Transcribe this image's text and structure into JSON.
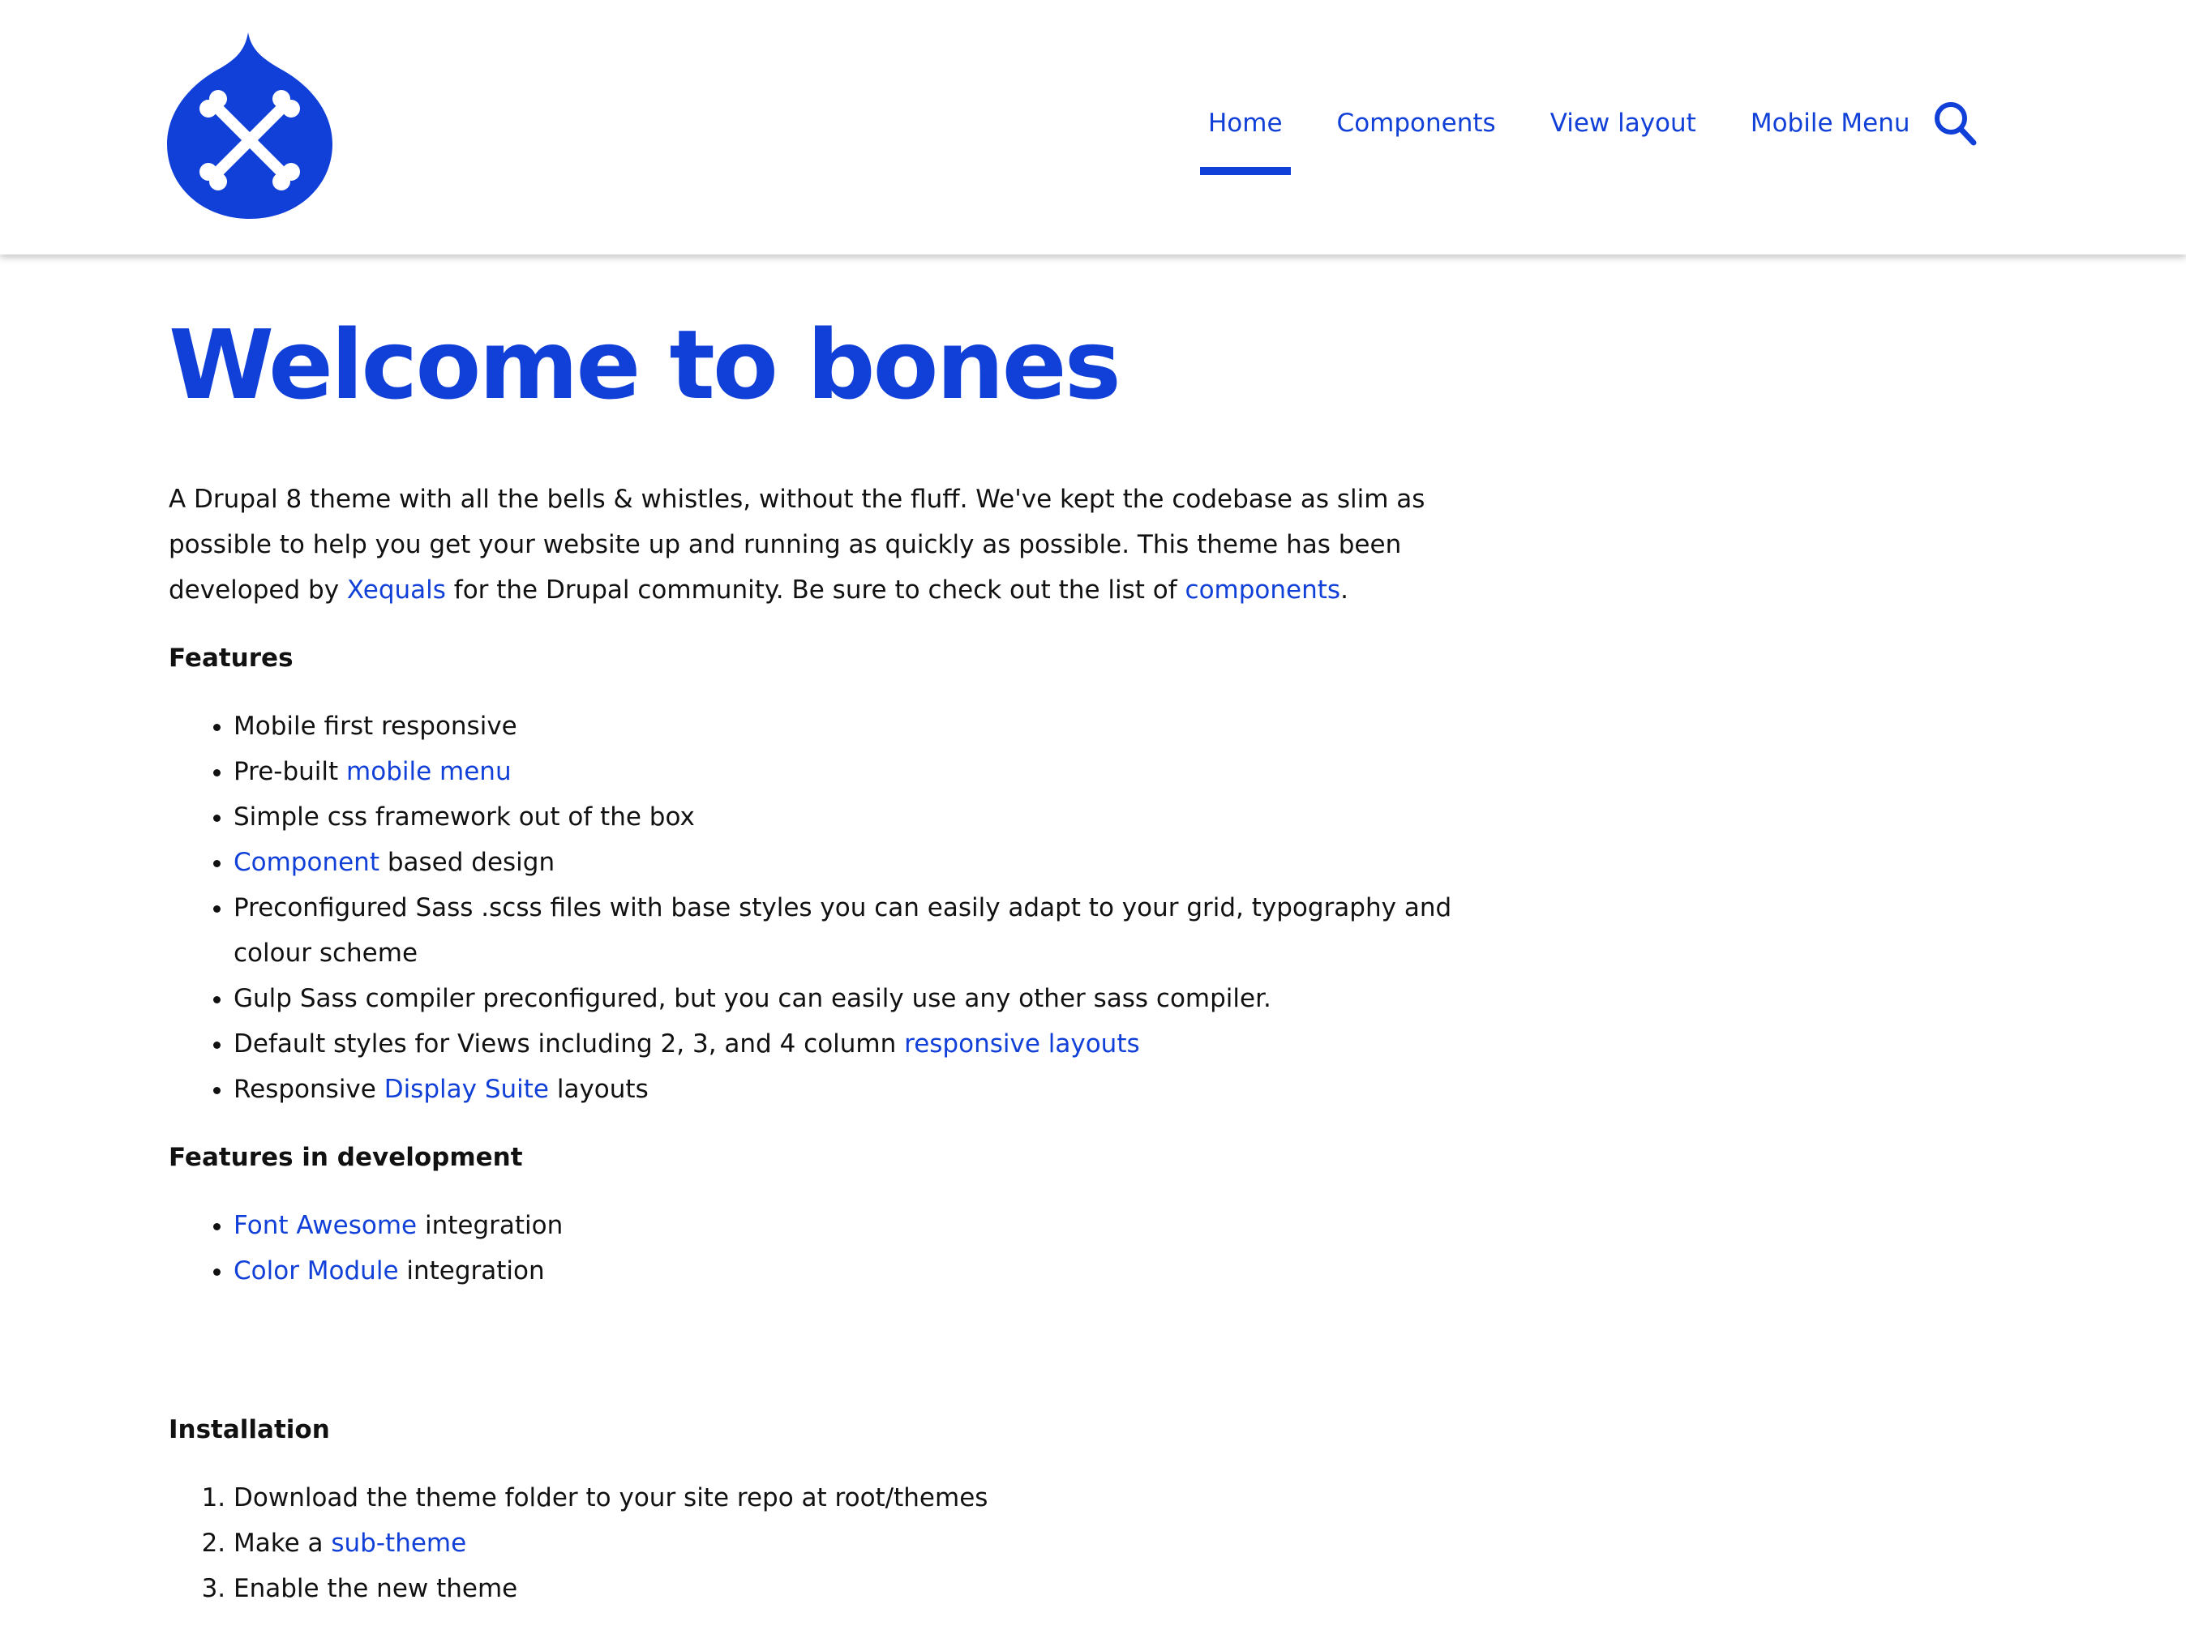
{
  "colors": {
    "accent": "#1140d8",
    "text": "#111111",
    "background": "#ffffff"
  },
  "header": {
    "logo_icon": "drupal-drop-crossbones-logo",
    "nav": [
      {
        "label": "Home",
        "active": true
      },
      {
        "label": "Components",
        "active": false
      },
      {
        "label": "View layout",
        "active": false
      },
      {
        "label": "Mobile Menu",
        "active": false
      }
    ],
    "search_icon": "search-icon"
  },
  "main": {
    "title": "Welcome to bones",
    "intro": {
      "text_1": "A Drupal 8 theme with all the bells & whistles, without the fluff. We've kept the codebase as slim as possible to help you get your website up and running as quickly as possible. This theme has been developed by ",
      "link_1": "Xequals",
      "text_2": " for the Drupal community. Be sure to check out the list of ",
      "link_2": "components",
      "text_3": "."
    },
    "features": {
      "heading": "Features",
      "items": [
        {
          "before": "Mobile first responsive",
          "link": "",
          "after": ""
        },
        {
          "before": "Pre-built ",
          "link": "mobile menu",
          "after": ""
        },
        {
          "before": "Simple css framework out of the box",
          "link": "",
          "after": ""
        },
        {
          "before": "",
          "link": "Component",
          "after": " based design"
        },
        {
          "before": "Preconfigured Sass .scss files with base styles you can easily adapt to your grid, typography and colour scheme",
          "link": "",
          "after": ""
        },
        {
          "before": "Gulp Sass compiler preconfigured, but you can easily use any other sass compiler.",
          "link": "",
          "after": ""
        },
        {
          "before": "Default styles for Views including 2, 3, and 4 column ",
          "link": "responsive layouts",
          "after": ""
        },
        {
          "before": "Responsive ",
          "link": "Display Suite",
          "after": " layouts"
        }
      ]
    },
    "features_dev": {
      "heading": "Features in development",
      "items": [
        {
          "before": "",
          "link": "Font Awesome",
          "after": " integration"
        },
        {
          "before": "",
          "link": "Color Module",
          "after": " integration"
        }
      ]
    },
    "installation": {
      "heading": "Installation",
      "items": [
        {
          "before": "Download the theme folder to your site repo at root/themes",
          "link": "",
          "after": ""
        },
        {
          "before": "Make a ",
          "link": "sub-theme",
          "after": ""
        },
        {
          "before": "Enable the new theme",
          "link": "",
          "after": ""
        }
      ]
    }
  }
}
